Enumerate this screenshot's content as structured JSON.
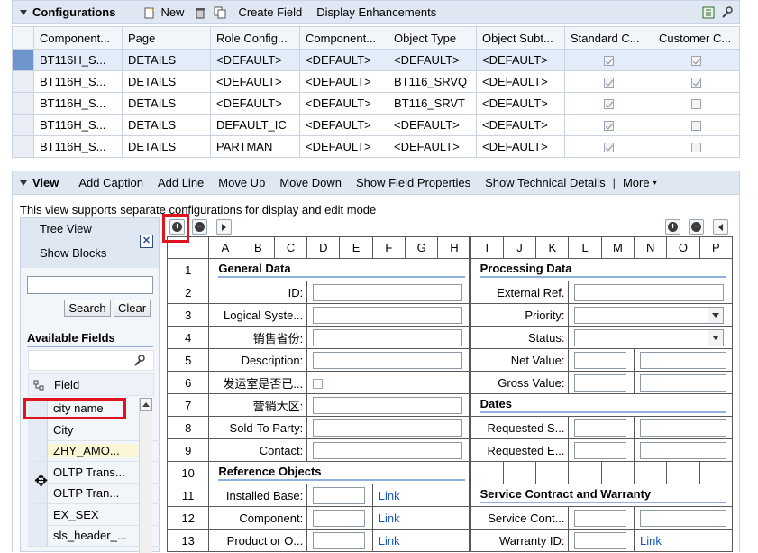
{
  "config": {
    "title": "Configurations",
    "toolbar": {
      "new_label": "New",
      "create_field_label": "Create Field",
      "display_enh_label": "Display Enhancements"
    },
    "columns": [
      "Component...",
      "Page",
      "Role Config...",
      "Component...",
      "Object Type",
      "Object Subt...",
      "Standard C...",
      "Customer C..."
    ],
    "rows": [
      {
        "c1": "BT116H_S...",
        "c2": "DETAILS",
        "c3": "<DEFAULT>",
        "c4": "<DEFAULT>",
        "c5": "<DEFAULT>",
        "c6": "<DEFAULT>",
        "std": true,
        "cust": true,
        "selected": true
      },
      {
        "c1": "BT116H_S...",
        "c2": "DETAILS",
        "c3": "<DEFAULT>",
        "c4": "<DEFAULT>",
        "c5": "BT116_SRVQ",
        "c6": "<DEFAULT>",
        "std": true,
        "cust": true
      },
      {
        "c1": "BT116H_S...",
        "c2": "DETAILS",
        "c3": "<DEFAULT>",
        "c4": "<DEFAULT>",
        "c5": "BT116_SRVT",
        "c6": "<DEFAULT>",
        "std": true,
        "cust": false
      },
      {
        "c1": "BT116H_S...",
        "c2": "DETAILS",
        "c3": "DEFAULT_IC",
        "c4": "<DEFAULT>",
        "c5": "<DEFAULT>",
        "c6": "<DEFAULT>",
        "std": true,
        "cust": false
      },
      {
        "c1": "BT116H_S...",
        "c2": "DETAILS",
        "c3": "PARTMAN",
        "c4": "<DEFAULT>",
        "c5": "<DEFAULT>",
        "c6": "<DEFAULT>",
        "std": true,
        "cust": false
      }
    ]
  },
  "view": {
    "title": "View",
    "toolbar": {
      "add_caption": "Add Caption",
      "add_line": "Add Line",
      "move_up": "Move Up",
      "move_down": "Move Down",
      "show_field_props": "Show Field Properties",
      "show_tech": "Show Technical Details",
      "more": "More"
    },
    "info_text": "This view supports separate configurations for display and edit mode"
  },
  "sidebar": {
    "tree_view": "Tree View",
    "show_blocks": "Show Blocks",
    "search_value": "",
    "search_btn": "Search",
    "clear_btn": "Clear",
    "available_fields": "Available Fields",
    "field_header": "Field",
    "fields": [
      "city name",
      "City",
      "ZHY_AMO...",
      "OLTP Trans...",
      "OLTP Tran...",
      "EX_SEX",
      "sls_header_..."
    ]
  },
  "grid": {
    "left_cols": [
      "A",
      "B",
      "C",
      "D",
      "E",
      "F",
      "G",
      "H"
    ],
    "right_cols": [
      "I",
      "J",
      "K",
      "L",
      "M",
      "N",
      "O",
      "P"
    ],
    "rows": [
      {
        "n": "1",
        "left": {
          "section": "General Data"
        },
        "right": {
          "section": "Processing Data"
        }
      },
      {
        "n": "2",
        "left": {
          "label": "ID:"
        },
        "right": {
          "label": "External Ref."
        }
      },
      {
        "n": "3",
        "left": {
          "label": "Logical Syste..."
        },
        "right": {
          "label": "Priority:"
        }
      },
      {
        "n": "4",
        "left": {
          "label": "销售省份:"
        },
        "right": {
          "label": "Status:"
        }
      },
      {
        "n": "5",
        "left": {
          "label": "Description:"
        },
        "right": {
          "label": "Net Value:"
        }
      },
      {
        "n": "6",
        "left": {
          "label": "发运室是否已..."
        },
        "right": {
          "label": "Gross Value:"
        }
      },
      {
        "n": "7",
        "left": {
          "label": "营销大区:"
        },
        "right": {
          "section": "Dates"
        }
      },
      {
        "n": "8",
        "left": {
          "label": "Sold-To Party:"
        },
        "right": {
          "label": "Requested S..."
        }
      },
      {
        "n": "9",
        "left": {
          "label": "Contact:"
        },
        "right": {
          "label": "Requested E..."
        }
      },
      {
        "n": "10",
        "left": {
          "section": "Reference Objects"
        },
        "right": {}
      },
      {
        "n": "11",
        "left": {
          "label": "Installed Base:",
          "link": "Link"
        },
        "right": {
          "section": "Service Contract and Warranty"
        }
      },
      {
        "n": "12",
        "left": {
          "label": "Component:",
          "link": "Link"
        },
        "right": {
          "label": "Service Cont..."
        }
      },
      {
        "n": "13",
        "left": {
          "label": "Product or O...",
          "link": "Link"
        },
        "right": {
          "label": "Warranty ID:",
          "link": "Link"
        }
      }
    ]
  }
}
